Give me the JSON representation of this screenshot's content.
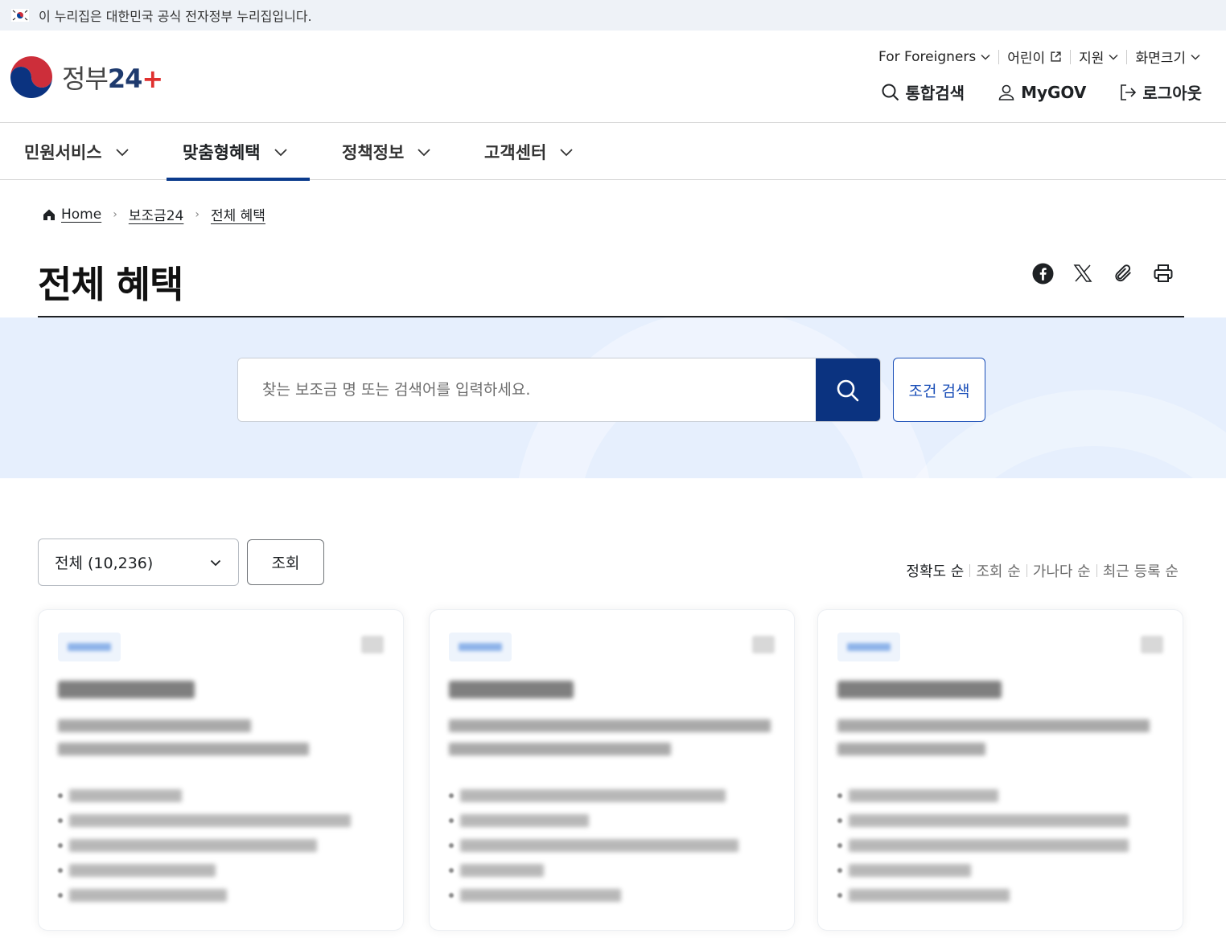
{
  "banner": {
    "text": "이 누리집은 대한민국 공식 전자정부 누리집입니다."
  },
  "logo": {
    "text": "정부",
    "number": "24",
    "plus": "+"
  },
  "util_nav": [
    {
      "label": "For Foreigners",
      "icon": "chevron-down-icon"
    },
    {
      "label": "어린이",
      "icon": "external-link-icon"
    },
    {
      "label": "지원",
      "icon": "chevron-down-icon"
    },
    {
      "label": "화면크기",
      "icon": "chevron-down-icon"
    }
  ],
  "main_util": {
    "search": "통합검색",
    "mygov": "MyGOV",
    "logout": "로그아웃"
  },
  "gnb": [
    {
      "label": "민원서비스",
      "active": false
    },
    {
      "label": "맞춤형혜택",
      "active": true
    },
    {
      "label": "정책정보",
      "active": false
    },
    {
      "label": "고객센터",
      "active": false
    }
  ],
  "breadcrumb": [
    "Home",
    "보조금24",
    "전체 혜택"
  ],
  "page_title": "전체 혜택",
  "search": {
    "placeholder": "찾는 보조금 명 또는 검색어를 입력하세요.",
    "condition_button": "조건 검색"
  },
  "filter": {
    "selected": "전체 (10,236)",
    "view_button": "조회"
  },
  "sort": {
    "options": [
      "정확도 순",
      "조회 순",
      "가나다 순",
      "최근 등록 순"
    ],
    "active_index": 0
  },
  "colors": {
    "primary": "#0b3380",
    "accent_blue": "#1b4fb8",
    "band": "#e6effd",
    "logo_red": "#e0302f"
  }
}
